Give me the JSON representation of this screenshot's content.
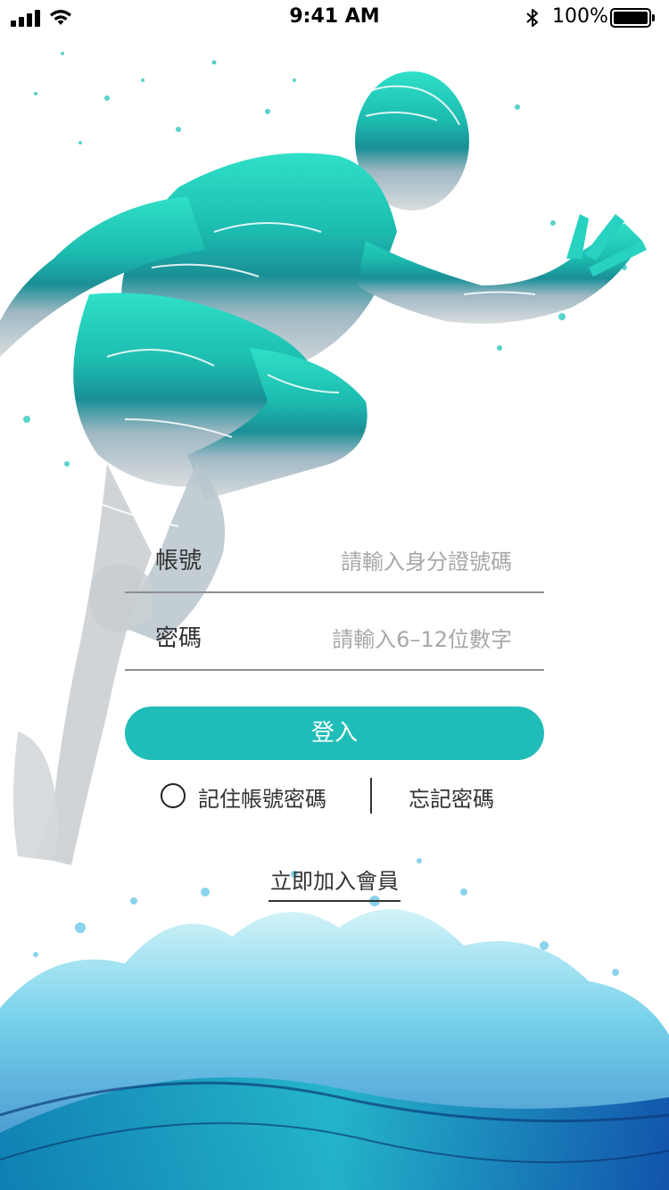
{
  "status_bar": {
    "time": "9:41 AM",
    "battery_percent": "100%"
  },
  "form": {
    "account": {
      "label": "帳號",
      "placeholder": "請輸入身分證號碼"
    },
    "password": {
      "label": "密碼",
      "placeholder": "請輸入6–12位數字"
    },
    "login_label": "登入",
    "remember_label": "記住帳號密碼",
    "forgot_label": "忘記密碼",
    "join_label": "立即加入會員"
  },
  "colors": {
    "accent": "#20bdb8",
    "runner_teal": "#1ec4b4",
    "splash_blue": "#1a8fd0"
  }
}
